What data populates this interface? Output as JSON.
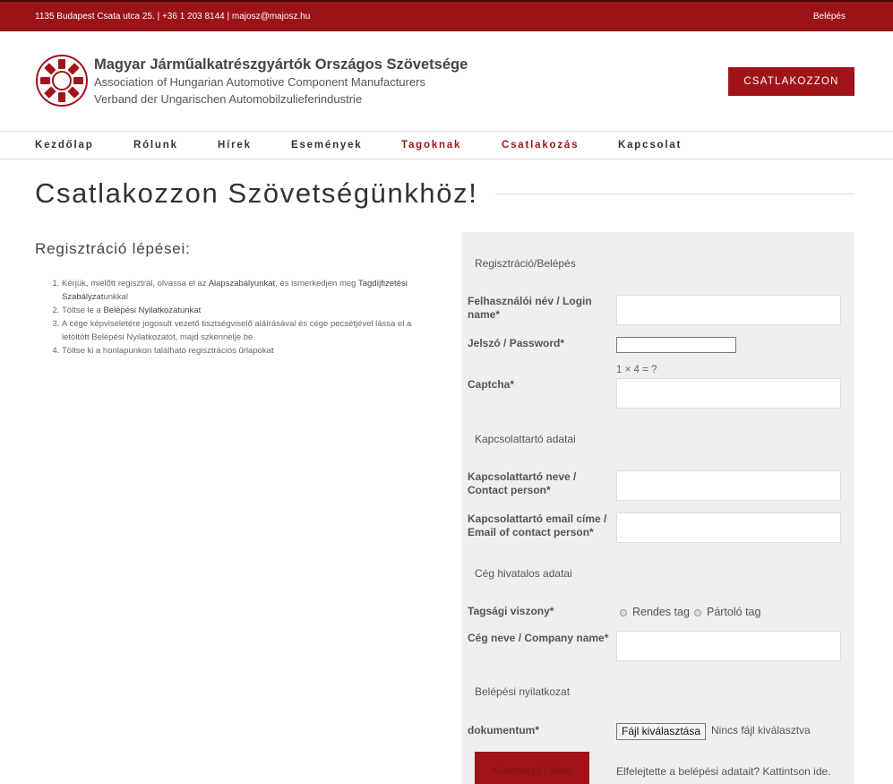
{
  "topbar": {
    "contact": "1135 Budapest Csata utca 25.  |  +36 1 203 8144  |  majosz@majosz.hu",
    "login": "Belépés"
  },
  "header": {
    "org_hu": "Magyar Járműalkatrészgyártók Országos Szövetsége",
    "org_en": "Association of Hungarian Automotive Component Manufacturers",
    "org_de": "Verband der Ungarischen Automobilzulieferindustrie",
    "join_button": "CSATLAKOZZON",
    "logo_icon": "gear-logo-icon",
    "brand_color": "#a01419"
  },
  "nav": {
    "items": [
      {
        "label": "Kezdőlap",
        "active": false
      },
      {
        "label": "Rólunk",
        "active": false
      },
      {
        "label": "Hírek",
        "active": false
      },
      {
        "label": "Események",
        "active": false
      },
      {
        "label": "Tagoknak",
        "active": true
      },
      {
        "label": "Csatlakozás",
        "active": true
      },
      {
        "label": "Kapcsolat",
        "active": false
      }
    ]
  },
  "page": {
    "title": "Csatlakozzon Szövetségünkhöz!",
    "steps_heading": "Regisztráció lépései:",
    "steps": [
      {
        "pre": "Kérjük, mielőtt regisztrál, olvassa el az ",
        "link1": "Alapszabályunkat",
        "mid": ", és ismerkedjen meg ",
        "link2": "Tagdíjfizetési Szabályzat",
        "post": "unkkal"
      },
      {
        "pre": "Töltse le a ",
        "link1": "Belépési Nyilatkozatunkat",
        "mid": "",
        "link2": "",
        "post": ""
      },
      {
        "pre": "A cége képviseletére jogosult vezető tisztségviselő aláírásával és cége pecsétjével lássa el a letöltött Belépési Nyilatkozatot, majd szkennelje be",
        "link1": "",
        "mid": "",
        "link2": "",
        "post": ""
      },
      {
        "pre": "Töltse ki a honlapunkon található regisztrációs űrlapokat",
        "link1": "",
        "mid": "",
        "link2": "",
        "post": ""
      }
    ]
  },
  "form": {
    "section_login": "Regisztráció/Belépés",
    "username_label": "Felhasználói név / Login name*",
    "password_label": "Jelszó / Password*",
    "captcha_label": "Captcha*",
    "captcha_question": "1 × 4 = ?",
    "section_contact": "Kapcsolattartó adatai",
    "contact_name_label": "Kapcsolattartó neve / Contact person*",
    "contact_email_label": "Kapcsolattartó email címe / Email of contact person*",
    "section_company": "Cég hivatalos adatai",
    "membership_label": "Tagsági viszony*",
    "membership_options": [
      "Rendes tag",
      "Pártoló tag"
    ],
    "company_name_label": "Cég neve / Company name*",
    "section_declaration": "Belépési nyilatkozat",
    "document_label": "dokumentum*",
    "file_button": "Fájl kiválasztása",
    "file_none": "Nincs fájl kiválasztva",
    "next_button": "Következő / Next",
    "forgot_text": "Elfelejtette a belépési adatait? Kattintson ide."
  }
}
